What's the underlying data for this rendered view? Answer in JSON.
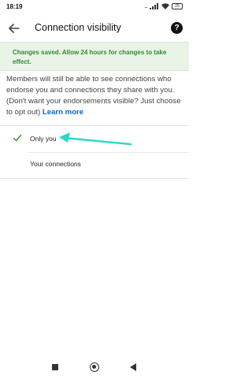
{
  "status_bar": {
    "time": "18:19",
    "signal_dots": "...",
    "battery": "25"
  },
  "header": {
    "title": "Connection visibility",
    "back_icon": "arrow-left-icon",
    "help_icon": "question-circle-icon",
    "help_glyph": "?"
  },
  "banner": {
    "message": "Changes saved. Allow 24 hours for changes to take effect.",
    "color": "#2f8a2f"
  },
  "main": {
    "description": "Members will still be able to see connections who endorse you and connections they share with you. (Don't want your endorsements visible? Just choose to opt out)",
    "learn_more": "Learn more",
    "link_color": "#0a66c2",
    "options": [
      {
        "label": "Only you",
        "selected": true
      },
      {
        "label": "Your connections",
        "selected": false
      }
    ],
    "check_color": "#2f8a2f"
  },
  "annotation": {
    "arrow_color": "#2fd6c8"
  },
  "nav": {
    "recents_icon": "square-icon",
    "home_icon": "circle-icon",
    "back_icon": "triangle-back-icon"
  }
}
